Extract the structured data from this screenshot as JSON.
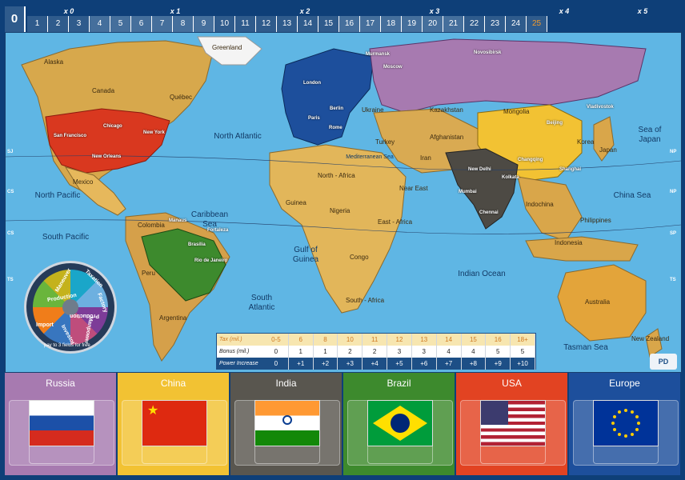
{
  "track": {
    "zero": "0",
    "multipliers": [
      {
        "label": "x 0"
      },
      {
        "label": "x 1"
      },
      {
        "label": "x 2"
      },
      {
        "label": "x 3"
      },
      {
        "label": "x 4"
      },
      {
        "label": "x 5"
      }
    ],
    "cells": [
      "1",
      "2",
      "3",
      "4",
      "5",
      "6",
      "7",
      "8",
      "9",
      "10",
      "11",
      "12",
      "13",
      "14",
      "15",
      "16",
      "17",
      "18",
      "19",
      "20",
      "21",
      "22",
      "23",
      "24",
      "25"
    ]
  },
  "map": {
    "oceans": [
      {
        "name": "North Atlantic"
      },
      {
        "name": "North Pacific"
      },
      {
        "name": "South Pacific"
      },
      {
        "name": "Caribbean Sea"
      },
      {
        "name": "Gulf of Guinea"
      },
      {
        "name": "South Atlantic"
      },
      {
        "name": "Indian Ocean"
      },
      {
        "name": "Sea of Japan"
      },
      {
        "name": "China Sea"
      },
      {
        "name": "Tasman Sea"
      },
      {
        "name": "Mediterranean Sea"
      }
    ],
    "territories": [
      "Alaska",
      "Canada",
      "Québec",
      "Mexico",
      "Colombia",
      "Peru",
      "Argentina",
      "Greenland",
      "Guinea",
      "Nigeria",
      "Congo",
      "East - Africa",
      "South - Africa",
      "North - Africa",
      "Ukraine",
      "Turkey",
      "Iran",
      "Afghanistan",
      "Near East",
      "Kazakhstan",
      "Mongolia",
      "Korea",
      "Japan",
      "Indochina",
      "Philippines",
      "Indonesia",
      "Australia",
      "New Zealand"
    ],
    "cities": [
      "San Francisco",
      "Chicago",
      "New York",
      "New Orleans",
      "London",
      "Berlin",
      "Paris",
      "Rome",
      "Murmansk",
      "Moscow",
      "Novosibirsk",
      "Vladivostok",
      "Beijing",
      "Changqing",
      "Shanghai",
      "New Delhi",
      "Kolkata",
      "Mumbai",
      "Chennai",
      "Manaus",
      "Fortaleza",
      "Brasilia",
      "Rio de Janeiro"
    ],
    "routes": [
      "SJ",
      "CS",
      "CS",
      "TS",
      "NP",
      "NP",
      "SP",
      "TS"
    ]
  },
  "wheel": {
    "labels": [
      "Production",
      "Import",
      "Investor",
      "Manpower",
      "Factory",
      "Taxation",
      "Production",
      "Maneuver"
    ],
    "footer": "pay to 3 fields for free"
  },
  "bonus_table": {
    "rows": [
      {
        "label": "Tax (mil.)",
        "values": [
          "0-5",
          "6",
          "8",
          "10",
          "11",
          "12",
          "13",
          "14",
          "15",
          "16",
          "18+"
        ]
      },
      {
        "label": "Bonus (mil.)",
        "values": [
          "0",
          "1",
          "1",
          "2",
          "2",
          "3",
          "3",
          "4",
          "4",
          "5",
          "5"
        ]
      },
      {
        "label": "Power Increase",
        "values": [
          "0",
          "+1",
          "+2",
          "+3",
          "+4",
          "+5",
          "+6",
          "+7",
          "+8",
          "+9",
          "+10"
        ]
      }
    ]
  },
  "panels": [
    {
      "name": "Russia",
      "bg": "#a77ab0"
    },
    {
      "name": "China",
      "bg": "#f2c233"
    },
    {
      "name": "India",
      "bg": "#59564f"
    },
    {
      "name": "Brazil",
      "bg": "#3d8a2d"
    },
    {
      "name": "USA",
      "bg": "#e24322"
    },
    {
      "name": "Europe",
      "bg": "#1d4f9c"
    }
  ],
  "logo": "PD"
}
